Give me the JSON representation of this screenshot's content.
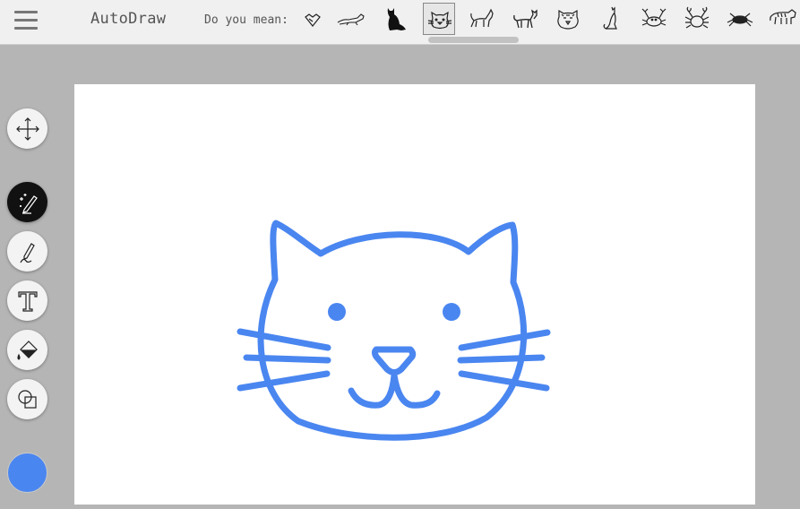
{
  "header": {
    "app_title": "AutoDraw",
    "suggest_label": "Do you mean:"
  },
  "suggestions": [
    {
      "name": "heart-outline",
      "selected": false
    },
    {
      "name": "running-cat-outline",
      "selected": false
    },
    {
      "name": "sitting-cat-silhouette",
      "selected": false
    },
    {
      "name": "cat-face",
      "selected": true
    },
    {
      "name": "standing-cat",
      "selected": false
    },
    {
      "name": "walking-cat",
      "selected": false
    },
    {
      "name": "tiger-face",
      "selected": false
    },
    {
      "name": "sitting-cat-outline",
      "selected": false
    },
    {
      "name": "crab",
      "selected": false
    },
    {
      "name": "crab-detailed",
      "selected": false
    },
    {
      "name": "crab-small",
      "selected": false
    },
    {
      "name": "tiger",
      "selected": false
    }
  ],
  "tools": [
    {
      "name": "move",
      "active": false
    },
    {
      "name": "autodraw",
      "active": true
    },
    {
      "name": "draw",
      "active": false
    },
    {
      "name": "type",
      "active": false
    },
    {
      "name": "fill",
      "active": false
    },
    {
      "name": "shape",
      "active": false
    }
  ],
  "colors": {
    "stroke": "#4a86f0",
    "selected_color": "#4a86f0"
  },
  "drawing": {
    "subject": "cat-face"
  }
}
